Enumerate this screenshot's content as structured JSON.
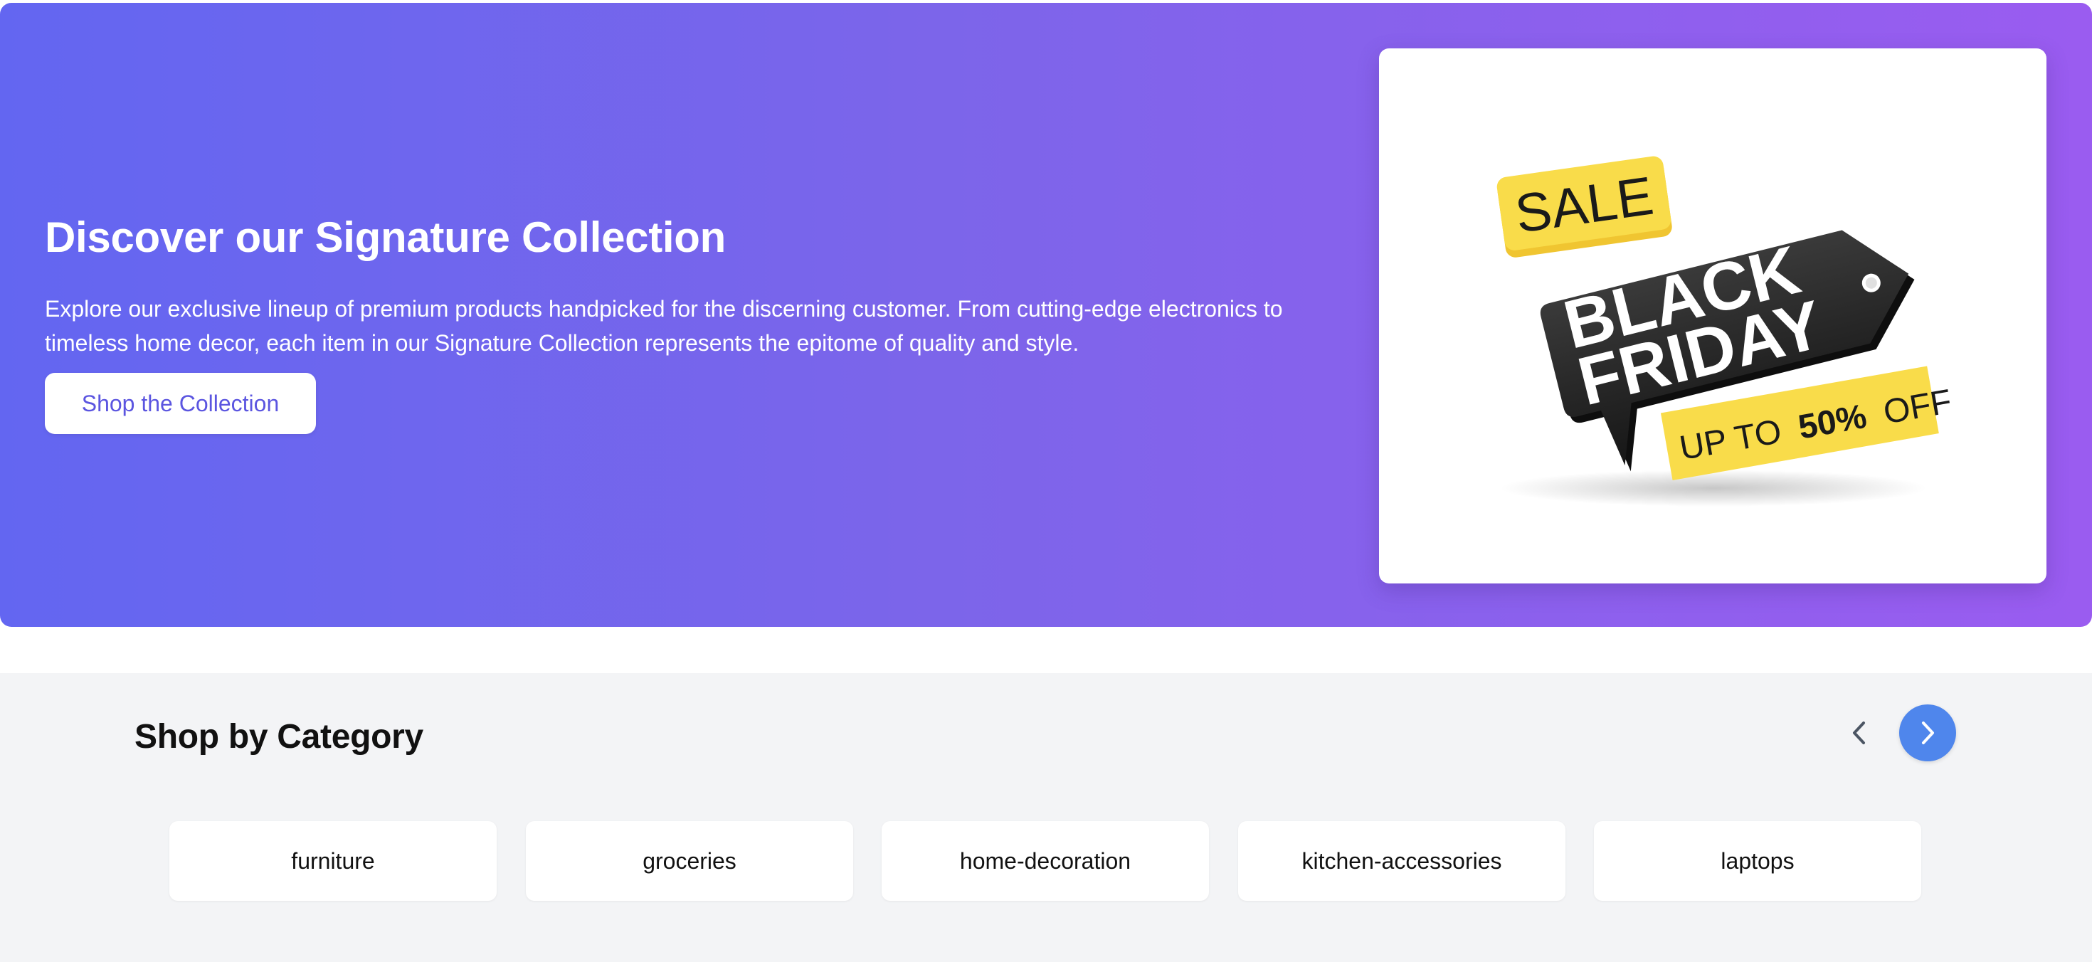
{
  "hero": {
    "title": "Discover our Signature Collection",
    "description": "Explore our exclusive lineup of premium products handpicked for the discerning customer. From cutting-edge electronics to timeless home decor, each item in our Signature Collection represents the epitome of quality and style.",
    "button_label": "Shop the Collection",
    "gradient_start": "#6366f1",
    "gradient_end": "#9a5cf0",
    "promo": {
      "sale": "SALE",
      "line1": "BLACK",
      "line2": "FRIDAY",
      "offer_prefix": "UP TO",
      "offer_value": "50%",
      "offer_suffix": "OFF",
      "tag_color": "#1f1f1f",
      "banner_color": "#f9dc4a"
    }
  },
  "categories": {
    "title": "Shop by Category",
    "prev_icon": "chevron-left-icon",
    "next_icon": "chevron-right-icon",
    "accent_color": "#4f86ec",
    "items": [
      {
        "label": "furniture"
      },
      {
        "label": "groceries"
      },
      {
        "label": "home-decoration"
      },
      {
        "label": "kitchen-accessories"
      },
      {
        "label": "laptops"
      }
    ]
  }
}
